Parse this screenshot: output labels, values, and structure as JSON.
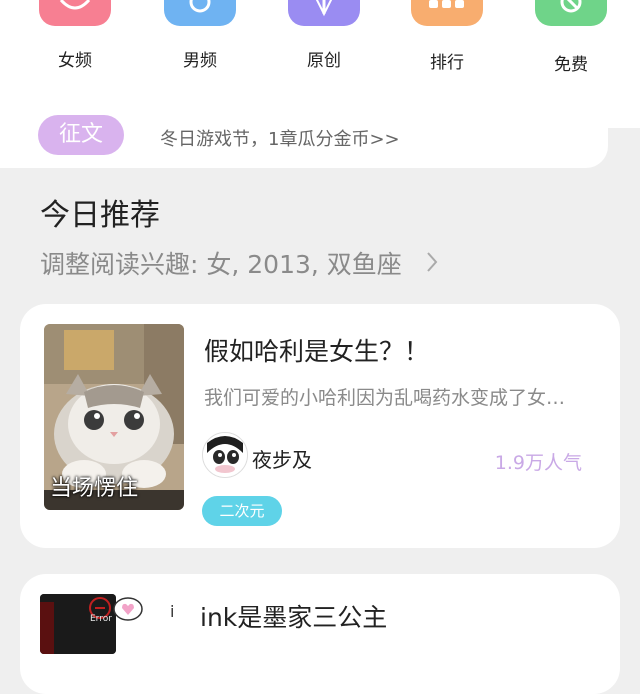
{
  "categories": [
    {
      "label": "女频",
      "icon": "female-channel-icon",
      "color": "#f77f92"
    },
    {
      "label": "男频",
      "icon": "male-channel-icon",
      "color": "#6fb3f2"
    },
    {
      "label": "原创",
      "icon": "original-icon",
      "color": "#9a8cf2"
    },
    {
      "label": "排行",
      "icon": "ranking-icon",
      "color": "#f8ad6f"
    },
    {
      "label": "免费",
      "icon": "free-icon",
      "color": "#6fd489"
    }
  ],
  "banner": {
    "tag": "征文",
    "text": "冬日游戏节，1章瓜分金币>>"
  },
  "recommend": {
    "title": "今日推荐",
    "preference": "调整阅读兴趣: 女, 2013, 双鱼座"
  },
  "books": [
    {
      "title": "假如哈利是女生？！",
      "description": "我们可爱的小哈利因为乱喝药水变成了女生……",
      "cover_caption": "当场愣住",
      "author": "夜步及",
      "popularity": "1.9万人气",
      "genre": "二次元"
    },
    {
      "title": "ink是墨家三公主",
      "cover_text": "Error",
      "side_text": "i"
    }
  ]
}
